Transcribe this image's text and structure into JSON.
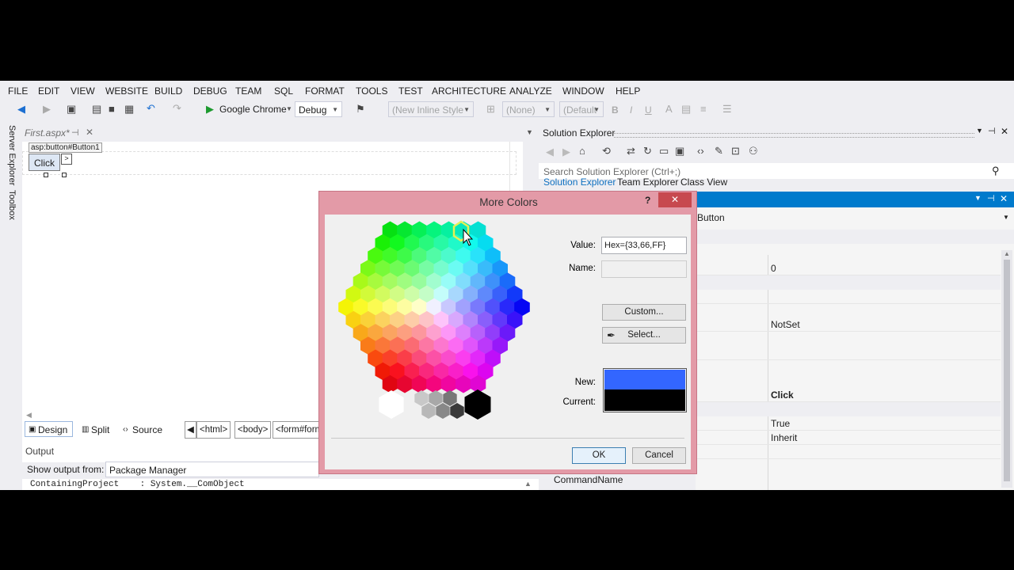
{
  "menu": [
    "FILE",
    "EDIT",
    "VIEW",
    "WEBSITE",
    "BUILD",
    "DEBUG",
    "TEAM",
    "SQL",
    "FORMAT",
    "TOOLS",
    "TEST",
    "ARCHITECTURE",
    "ANALYZE",
    "WINDOW",
    "HELP"
  ],
  "toolbar": {
    "run_target": "Google Chrome",
    "config": "Debug",
    "style_combo": "(New Inline Style",
    "class_combo": "(None)",
    "font_combo": "(Default",
    "bold": "B",
    "italic": "I",
    "underline": "U"
  },
  "side_tabs": [
    "Server Explorer",
    "Toolbox"
  ],
  "editor": {
    "tab_title": "First.aspx*",
    "element_tag": "asp:button#Button1",
    "button_text": "Click",
    "smart_tag": ">"
  },
  "view_tabs": [
    "Design",
    "Split",
    "Source"
  ],
  "breadcrumbs": [
    "<html>",
    "<body>",
    "<form#form"
  ],
  "output": {
    "title": "Output",
    "show_label": "Show output from:",
    "source": "Package Manager",
    "line": "ContainingProject    : System.__ComObject"
  },
  "solution_explorer": {
    "title": "Solution Explorer",
    "search_placeholder": "Search Solution Explorer (Ctrl+;)",
    "tabs": [
      "Solution Explorer",
      "Team Explorer",
      "Class View"
    ]
  },
  "properties": {
    "object": "Button",
    "values": {
      "v0": "0",
      "notset": "NotSet",
      "click": "Click",
      "true": "True",
      "inherit": "Inherit"
    },
    "command_name": "CommandName"
  },
  "dialog": {
    "title": "More Colors",
    "help": "?",
    "close": "✕",
    "value_label": "Value:",
    "value": "Hex={33,66,FF}",
    "name_label": "Name:",
    "name_value": "",
    "custom_button": "Custom...",
    "select_button": "Select...",
    "new_label": "New:",
    "current_label": "Current:",
    "new_color": "#3366ff",
    "current_color": "#000000",
    "ok": "OK",
    "cancel": "Cancel"
  }
}
